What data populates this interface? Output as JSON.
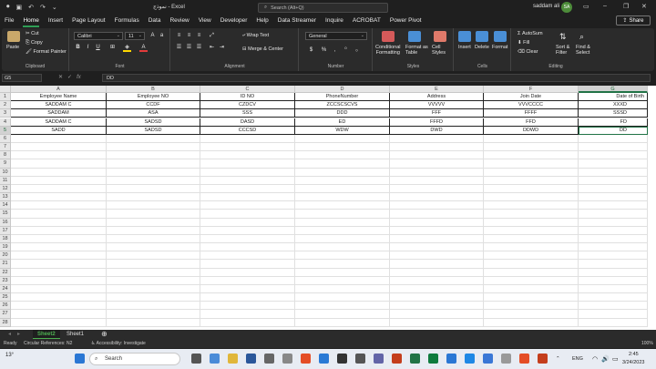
{
  "titlebar": {
    "doc_title": "نموذج  -  Excel",
    "search_placeholder": "Search (Alt+Q)",
    "user_name": "saddam ali",
    "avatar_initials": "SA"
  },
  "tabs": [
    "File",
    "Home",
    "Insert",
    "Page Layout",
    "Formulas",
    "Data",
    "Review",
    "View",
    "Developer",
    "Help",
    "Data Streamer",
    "Inquire",
    "ACROBAT",
    "Power Pivot"
  ],
  "active_tab": "Home",
  "share_label": "Share",
  "ribbon": {
    "clipboard": {
      "label": "Clipboard",
      "paste": "Paste",
      "cut": "Cut",
      "copy": "Copy",
      "format_painter": "Format Painter"
    },
    "font": {
      "label": "Font",
      "font_name": "Calibri",
      "font_size": "11"
    },
    "alignment": {
      "label": "Alignment",
      "wrap_text": "Wrap Text",
      "merge_center": "Merge & Center"
    },
    "number": {
      "label": "Number",
      "format": "General"
    },
    "styles": {
      "label": "Styles",
      "conditional": "Conditional\nFormatting",
      "format_as_table": "Format as\nTable",
      "cell_styles": "Cell\nStyles"
    },
    "cells": {
      "label": "Cells",
      "insert": "Insert",
      "delete": "Delete",
      "format": "Format"
    },
    "editing": {
      "label": "Editing",
      "autosum": "AutoSum",
      "fill": "Fill",
      "clear": "Clear",
      "sort_filter": "Sort &\nFilter",
      "find_select": "Find &\nSelect"
    }
  },
  "formula_bar": {
    "name_box": "G5",
    "formula": "DD"
  },
  "columns": [
    "A",
    "B",
    "C",
    "D",
    "E",
    "F",
    "G"
  ],
  "selected_column": "G",
  "selected_row": 5,
  "table": {
    "headers": [
      "Employee Name",
      "Employee NO",
      "ID NO",
      "PhoneNumber",
      "Address",
      "Join Date",
      "Date of Birth"
    ],
    "rows": [
      [
        "SADDAM C",
        "CCDF",
        "CZDCV",
        "ZCCSCSCVS",
        "VVVVV",
        "VVVCCCC",
        "XXXD"
      ],
      [
        "SADDAM",
        "ASA",
        "SSS",
        "DDD",
        "FFF",
        "FFFF",
        "SSSD"
      ],
      [
        "SADDAM C",
        "SADSD",
        "DASD",
        "ED",
        "FFFD",
        "FFD",
        "FD"
      ],
      [
        "SADD",
        "SADSD",
        "CCCSD",
        "WDW",
        "DWD",
        "DDWD",
        "DD"
      ]
    ]
  },
  "sheets": [
    "Sheet2",
    "Sheet1"
  ],
  "active_sheet": "Sheet2",
  "status": {
    "ready": "Ready",
    "circular": "Circular References: N2",
    "accessibility": "Accessibility: Investigate",
    "zoom": "100%"
  },
  "taskbar": {
    "weather_temp": "13°",
    "search": "Search",
    "lang": "ENG",
    "time": "2:45",
    "date": "3/24/2023"
  }
}
